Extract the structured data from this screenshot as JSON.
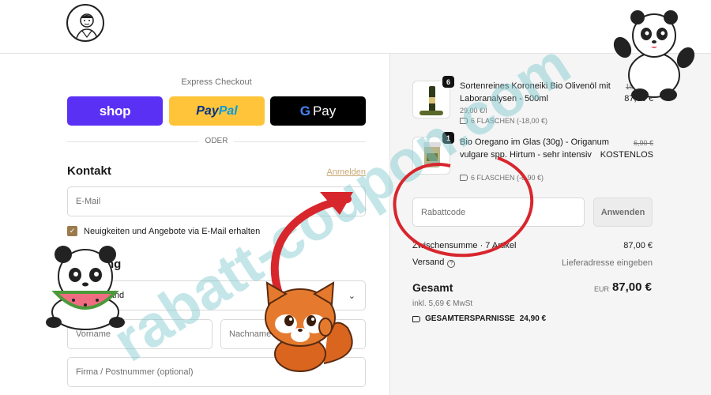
{
  "express": {
    "title": "Express Checkout",
    "shop_label": "shop",
    "paypal_label_1": "Pay",
    "paypal_label_2": "Pal",
    "gpay_g": "G",
    "gpay_label": "Pay",
    "divider": "ODER"
  },
  "contact": {
    "title": "Kontakt",
    "login_link": "Anmelden",
    "email_placeholder": "E-Mail",
    "newsletter_label": "Neuigkeiten und Angebote via E-Mail erhalten"
  },
  "delivery": {
    "title": "Lieferung",
    "country_value": "Deutschland",
    "first_name_placeholder": "Vorname",
    "last_name_placeholder": "Nachname",
    "company_placeholder": "Firma / Postnummer (optional)"
  },
  "cart": {
    "items": [
      {
        "qty": "6",
        "name": "Sortenreines Koroneiki Bio Olivenöl mit Laboranalysen - 500ml",
        "unit_price": "29,00 €/l",
        "discount": "6 FLASCHEN (-18,00 €)",
        "old_price": "105,00 €",
        "price": "87,00 €"
      },
      {
        "qty": "1",
        "name": "Bio Oregano im Glas (30g) - Origanum vulgare spp. Hirtum - sehr intensiv",
        "discount": "6 FLASCHEN (-6,90 €)",
        "old_price": "6,90 €",
        "price": "KOSTENLOS"
      }
    ],
    "discount_placeholder": "Rabattcode",
    "apply_label": "Anwenden"
  },
  "summary": {
    "subtotal_label": "Zwischensumme · 7 Artikel",
    "subtotal_value": "87,00 €",
    "shipping_label": "Versand",
    "shipping_value": "Lieferadresse eingeben",
    "total_label": "Gesamt",
    "currency": "EUR",
    "total_value": "87,00 €",
    "vat": "inkl. 5,69 € MwSt",
    "savings_label": "GESAMTERSPARNISSE",
    "savings_value": "24,90 €"
  },
  "watermark": "rabatt-coupon.com",
  "colors": {
    "shop": "#5a31f4",
    "paypal": "#ffc439",
    "gpay": "#000000",
    "accent": "#9b7a4c",
    "arrow": "#d8262d",
    "watermark": "#7cc7cf"
  }
}
